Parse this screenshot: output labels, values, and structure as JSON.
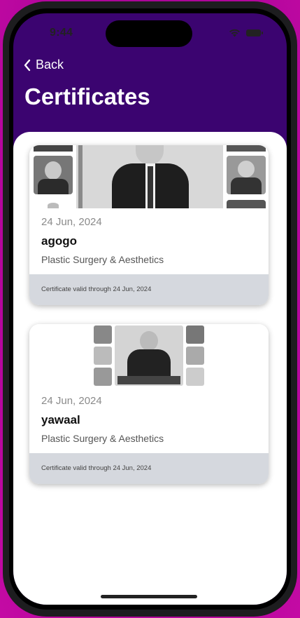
{
  "status_bar": {
    "time": "9:44"
  },
  "nav": {
    "back_label": "Back",
    "title": "Certificates"
  },
  "certificates": [
    {
      "date": "24 Jun, 2024",
      "name": "agogo",
      "specialty": "Plastic Surgery & Aesthetics",
      "validity": "Certificate valid through 24 Jun, 2024"
    },
    {
      "date": "24 Jun, 2024",
      "name": "yawaal",
      "specialty": "Plastic Surgery & Aesthetics",
      "validity": "Certificate valid through 24 Jun, 2024"
    }
  ]
}
